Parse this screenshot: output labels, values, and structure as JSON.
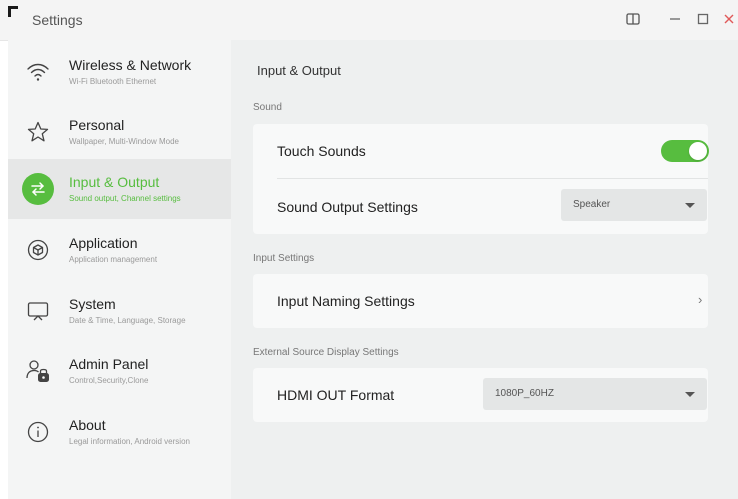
{
  "window": {
    "title": "Settings",
    "split_icon": "split-view-icon",
    "minimize_icon": "minimize-icon",
    "maximize_icon": "maximize-icon",
    "close_icon": "close-icon",
    "close_color": "#e05a5a"
  },
  "accent_color": "#57bd3f",
  "sidebar": {
    "items": [
      {
        "label": "Wireless & Network",
        "subtitle": "Wi-Fi Bluetooth Ethernet",
        "icon": "wifi-icon"
      },
      {
        "label": "Personal",
        "subtitle": "Wallpaper, Multi-Window Mode",
        "icon": "star-icon"
      },
      {
        "label": "Input & Output",
        "subtitle": "Sound output, Channel settings",
        "icon": "swap-arrows-icon",
        "active": true
      },
      {
        "label": "Application",
        "subtitle": "Application management",
        "icon": "cube-icon"
      },
      {
        "label": "System",
        "subtitle": "Date & Time, Language, Storage",
        "icon": "monitor-icon"
      },
      {
        "label": "Admin Panel",
        "subtitle": "Control,Security,Clone",
        "icon": "admin-user-lock-icon"
      },
      {
        "label": "About",
        "subtitle": "Legal information, Android version",
        "icon": "info-icon"
      }
    ]
  },
  "main": {
    "title": "Input & Output",
    "sections": {
      "sound": {
        "label": "Sound",
        "touch_sounds": {
          "label": "Touch Sounds",
          "enabled": true
        },
        "sound_output": {
          "label": "Sound Output Settings",
          "value": "Speaker"
        }
      },
      "input_settings": {
        "label": "Input Settings",
        "input_naming": {
          "label": "Input Naming Settings",
          "chevron": "›"
        }
      },
      "external": {
        "label": "External Source Display Settings",
        "hdmi_out": {
          "label": "HDMI OUT Format",
          "value": "1080P_60HZ"
        }
      }
    }
  }
}
